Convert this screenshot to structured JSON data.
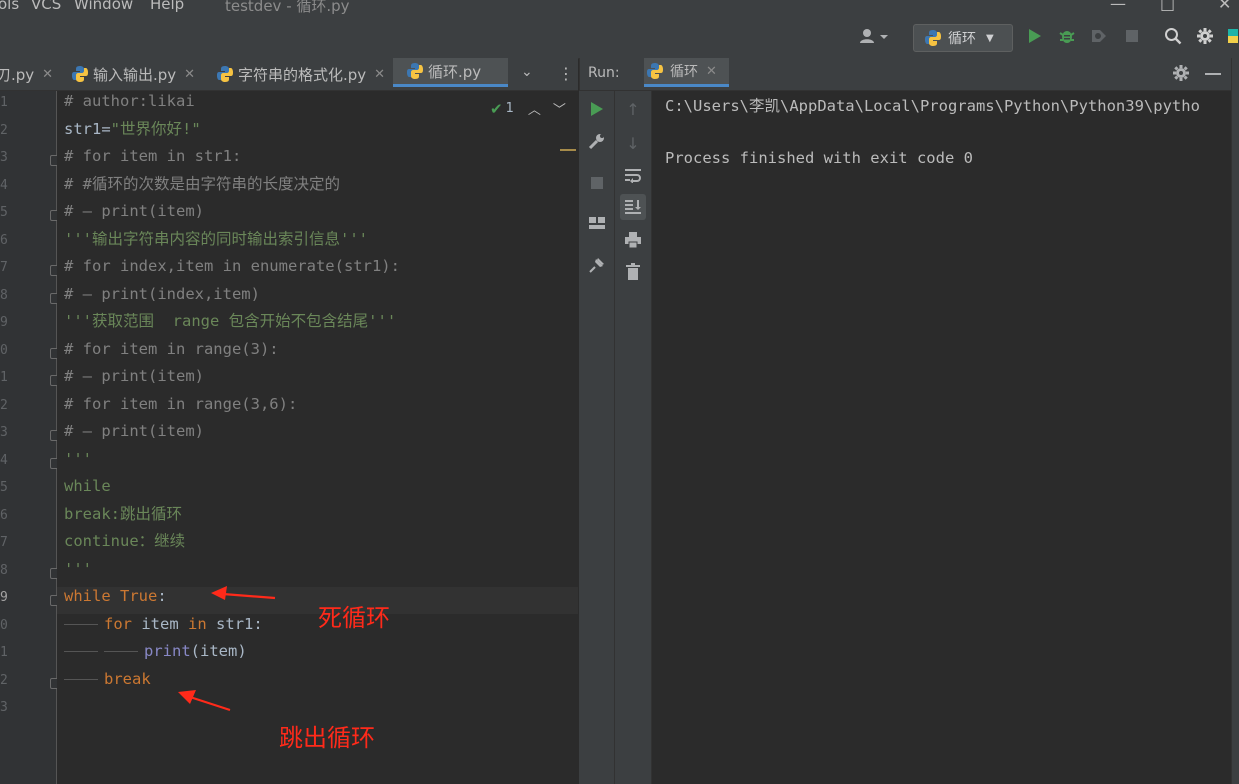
{
  "menu": {
    "items": [
      "ols",
      "VCS",
      "Window",
      "Help"
    ],
    "window_title": "testdev - 循环.py",
    "minimize": "—",
    "maximize": "□",
    "close": "✕"
  },
  "toolbar": {
    "run_config_label": "循环",
    "icons": [
      "user-icon",
      "run-icon",
      "debug-icon",
      "coverage-icon",
      "stop-icon",
      "search-icon",
      "settings-icon"
    ]
  },
  "tabs": [
    {
      "label": "刃.py",
      "active": false
    },
    {
      "label": "输入输出.py",
      "active": false
    },
    {
      "label": "字符串的格式化.py",
      "active": false
    },
    {
      "label": "循环.py",
      "active": true
    }
  ],
  "editor": {
    "inspection_count": "1",
    "line_numbers": [
      "1",
      "2",
      "3",
      "4",
      "5",
      "6",
      "7",
      "8",
      "9",
      "0",
      "1",
      "2",
      "3",
      "4",
      "5",
      "6",
      "7",
      "8",
      "9",
      "0",
      "1",
      "2",
      "3"
    ],
    "lines": [
      "# author:likai",
      "str1=\"世界你好!\"",
      "# for item in str1:",
      "# #循环的次数是由字符串的长度决定的",
      "# — print(item)",
      "'''输出字符串内容的同时输出索引信息'''",
      "# for index,item in enumerate(str1):",
      "# — print(index,item)",
      "'''获取范围  range 包含开始不包含结尾'''",
      "# for item in range(3):",
      "# — print(item)",
      "# for item in range(3,6):",
      "# — print(item)",
      "'''",
      "while",
      "break:跳出循环",
      "continue：继续",
      "'''",
      "while True:",
      "for item in str1:",
      "print(item)",
      "break",
      ""
    ]
  },
  "annotations": {
    "dead_loop": "死循环",
    "break_loop": "跳出循环"
  },
  "run_panel": {
    "label": "Run:",
    "tab_label": "循环",
    "console": [
      "C:\\Users\\李凯\\AppData\\Local\\Programs\\Python\\Python39\\pytho",
      "",
      "Process finished with exit code 0"
    ]
  },
  "colors": {
    "accent": "#4a88c7",
    "run_green": "#499c54",
    "annotation_red": "#ff2a1a"
  }
}
